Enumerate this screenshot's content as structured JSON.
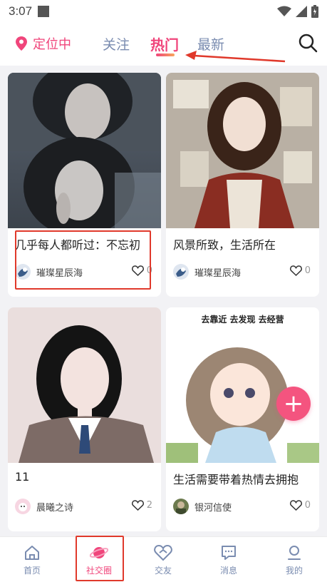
{
  "status_bar": {
    "time": "3:07"
  },
  "top_nav": {
    "location_label": "定位中",
    "tabs": [
      {
        "label": "关注",
        "active": false
      },
      {
        "label": "热门",
        "active": true
      },
      {
        "label": "最新",
        "active": false
      }
    ]
  },
  "posts": [
    {
      "title": "几乎每人都听过：不忘初",
      "author": "璀璨星辰海",
      "likes": "0"
    },
    {
      "title": "风景所致，生活所在",
      "author": "璀璨星辰海",
      "likes": "0"
    },
    {
      "title": "11",
      "author": "晨曦之诗",
      "likes": "2"
    },
    {
      "title": "生活需要带着热情去拥抱",
      "author": "银河信使",
      "likes": "0",
      "image_caption": "去靠近 去发现 去经营"
    }
  ],
  "fab": {
    "label": "+"
  },
  "bottom_nav": {
    "items": [
      {
        "label": "首页",
        "icon": "home-icon"
      },
      {
        "label": "社交圈",
        "icon": "planet-icon",
        "active": true
      },
      {
        "label": "交友",
        "icon": "heart-icon"
      },
      {
        "label": "消息",
        "icon": "message-icon"
      },
      {
        "label": "我的",
        "icon": "user-icon"
      }
    ]
  },
  "colors": {
    "accent": "#f0457b",
    "inactive": "#7a8cb0",
    "annotation": "#e0392b"
  }
}
